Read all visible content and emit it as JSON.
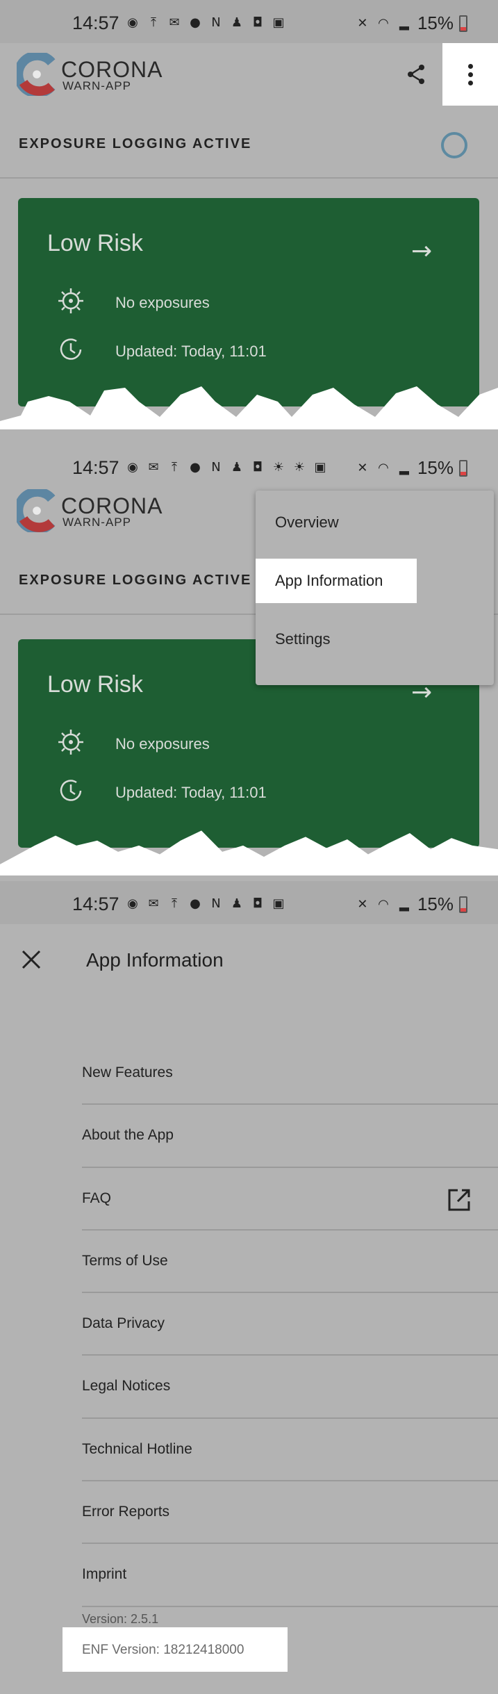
{
  "status_bar": {
    "time": "14:57",
    "battery": "15%"
  },
  "app": {
    "brand_name": "CORONA",
    "brand_sub": "WARN-APP"
  },
  "exposure": {
    "label": "EXPOSURE LOGGING ACTIVE"
  },
  "risk_card": {
    "title": "Low Risk",
    "exposures": "No exposures",
    "updated": "Updated: Today, 11:01",
    "color": "#1e5e33"
  },
  "overflow_menu": {
    "items": [
      {
        "label": "Overview"
      },
      {
        "label": "App Information"
      },
      {
        "label": "Settings"
      }
    ]
  },
  "app_information": {
    "title": "App Information",
    "items": [
      {
        "label": "New Features"
      },
      {
        "label": "About the App"
      },
      {
        "label": "FAQ"
      },
      {
        "label": "Terms of Use"
      },
      {
        "label": "Data Privacy"
      },
      {
        "label": "Legal Notices"
      },
      {
        "label": "Technical Hotline"
      },
      {
        "label": "Error Reports"
      },
      {
        "label": "Imprint"
      }
    ],
    "version": "Version: 2.5.1",
    "enf_version": "ENF Version: 18212418000"
  }
}
